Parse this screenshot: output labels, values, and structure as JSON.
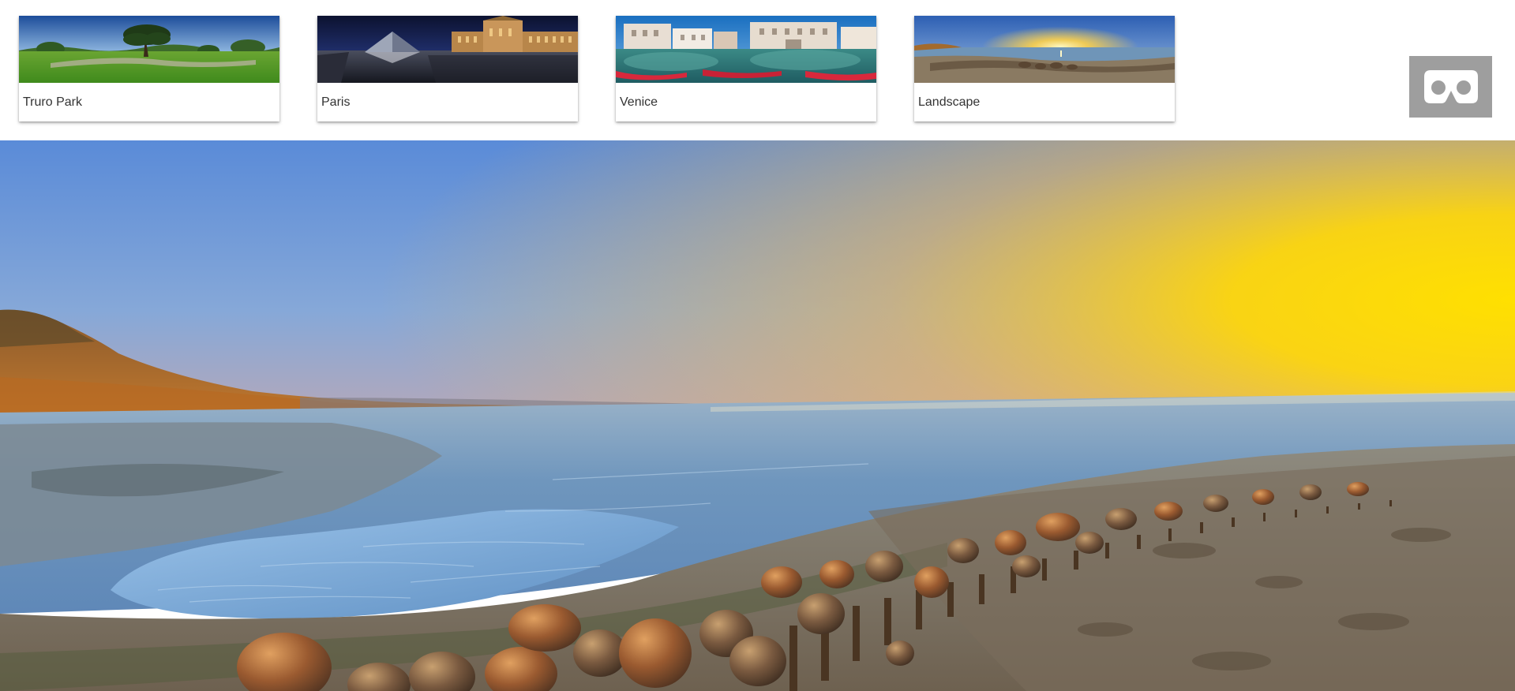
{
  "scenes": [
    {
      "label": "Truro Park",
      "thumb_icon": "park-panorama-thumbnail"
    },
    {
      "label": "Paris",
      "thumb_icon": "louvre-panorama-thumbnail"
    },
    {
      "label": "Venice",
      "thumb_icon": "venice-canal-panorama-thumbnail"
    },
    {
      "label": "Landscape",
      "thumb_icon": "seashore-sunset-panorama-thumbnail"
    }
  ],
  "vr_button": {
    "icon": "vr-headset-icon"
  },
  "viewer": {
    "current_scene": "Landscape",
    "scene_icon": "seashore-sunset-panorama"
  },
  "colors": {
    "vr_button_bg": "#9e9e9e",
    "card_label": "#333333",
    "sky_blue": "#5f8fd8",
    "sunset_yellow": "#ffd000",
    "water": "#7fa5c4"
  }
}
